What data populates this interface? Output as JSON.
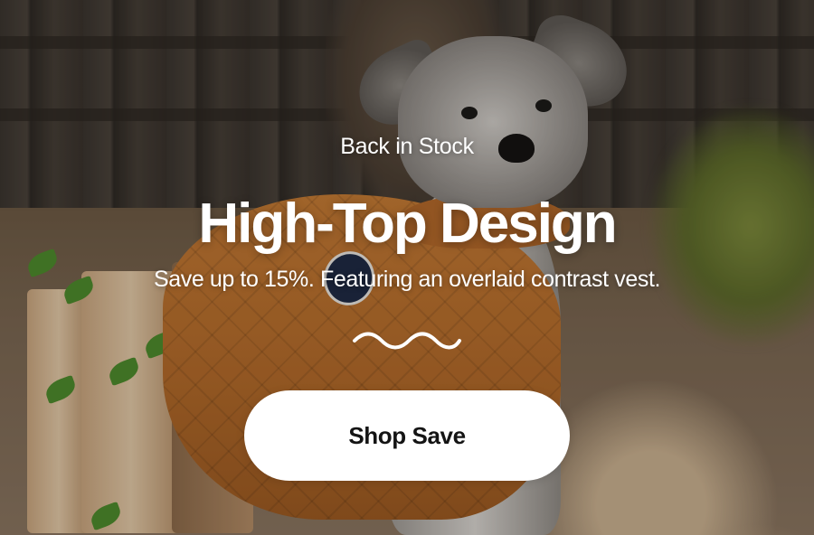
{
  "hero": {
    "eyebrow": "Back in Stock",
    "headline": "High-Top Design",
    "subtitle": "Save up to 15%. Featuring an overlaid contrast vest.",
    "cta_label": "Shop Save",
    "divider_icon": "wave-divider-icon"
  },
  "colors": {
    "text": "#ffffff",
    "button_bg": "#ffffff",
    "button_text": "#141414",
    "vest": "#c47a34"
  }
}
